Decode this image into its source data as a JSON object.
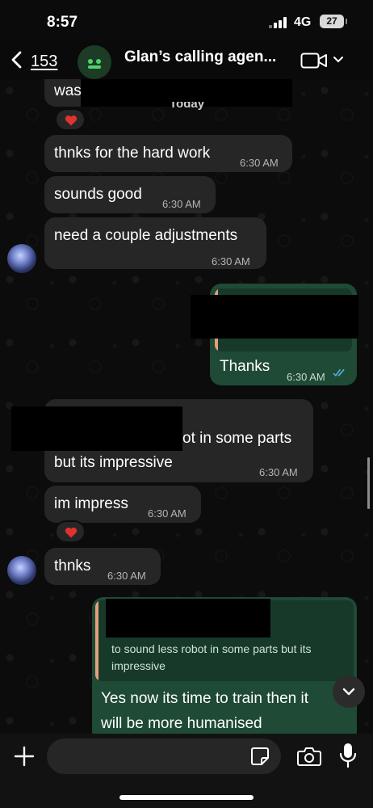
{
  "status_bar": {
    "time": "8:57",
    "network": "4G",
    "battery": "27"
  },
  "header": {
    "back_count": "153",
    "title": "Glan’s calling agen..."
  },
  "messages": [
    {
      "text": "was"
    },
    {
      "text": "Today"
    },
    {
      "text": "thnks for the hard work",
      "time": "6:30 AM"
    },
    {
      "text": "sounds good",
      "time": "6:30 AM"
    },
    {
      "text": "need a couple adjustments",
      "time": "6:30 AM"
    },
    {
      "text": "Thanks",
      "time": "6:30 AM"
    },
    {
      "text_line1": "ot in some parts",
      "text_line2": "but its impressive",
      "time": "6:30 AM"
    },
    {
      "text": "im impress",
      "time": "6:30 AM"
    },
    {
      "text": "thnks",
      "time": "6:30 AM"
    },
    {
      "quote_line1": "to sound less robot in some parts but its",
      "quote_line2": "impressive",
      "text_line1": "Yes now its time to train then it",
      "text_line2": "will be more humanised"
    }
  ],
  "icons": {
    "back": "chevron-left-icon",
    "video": "video-camera-icon",
    "reaction": "heart-icon",
    "read_receipt": "double-check-icon",
    "scroll_down": "chevron-down-icon",
    "attach": "plus-icon",
    "sticker": "sticker-icon",
    "camera": "camera-icon",
    "mic": "microphone-icon"
  },
  "composer": {
    "placeholder": ""
  },
  "colors": {
    "incoming_bubble": "#262626",
    "outgoing_bubble": "#1f4a36",
    "read_receipt": "#53bdeb",
    "reaction": "#e0322e"
  }
}
